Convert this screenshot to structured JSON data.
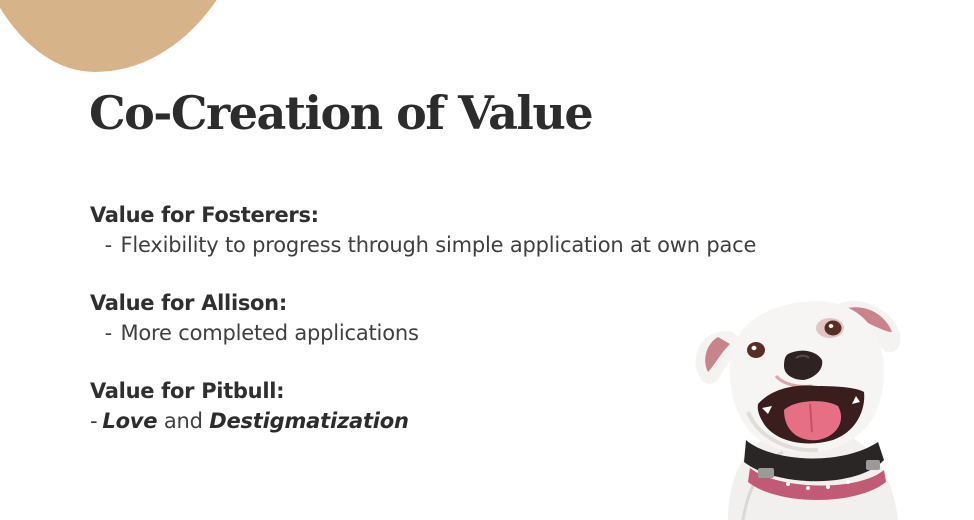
{
  "slide": {
    "title": "Co-Creation of Value",
    "sections": [
      {
        "heading": "Value for Fosterers:",
        "dash": "-",
        "text": "Flexibility to progress through simple application at own pace"
      },
      {
        "heading": "Value for Allison:",
        "dash": "-",
        "text": "More completed applications"
      },
      {
        "heading": "Value for Pitbull:",
        "dash": "-",
        "emph1": "Love",
        "connector": "and",
        "emph2": "Destigmatization"
      }
    ]
  },
  "colors": {
    "accent_blob": "#d7b389",
    "title_text": "#2c2c2c",
    "body_text": "#3f3f3f"
  },
  "image": {
    "icon": "smiling-pitbull-dog"
  }
}
